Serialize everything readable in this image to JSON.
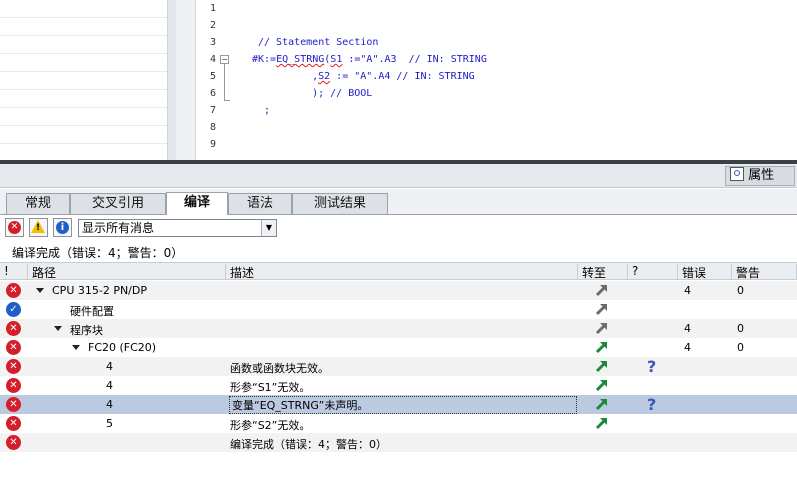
{
  "editor": {
    "line_numbers": [
      "1",
      "2",
      "3",
      "4",
      "5",
      "6",
      "7",
      "8",
      "9"
    ],
    "comment_line": "// Statement Section",
    "line4_prefix": "#K:=",
    "line4_func": "EQ_STRNG",
    "line4_paren": "(",
    "line4_param": "S1",
    "line4_rest": " :=\"A\".A3  // IN: STRING",
    "line5_prefix": "    ,",
    "line5_param": "S2",
    "line5_rest": " := \"A\".A4 // IN: STRING",
    "line6": "    ); // BOOL",
    "line7": ";"
  },
  "properties_button": {
    "label": "属性",
    "icon": "properties-icon"
  },
  "tabs": [
    {
      "label": "常规"
    },
    {
      "label": "交叉引用"
    },
    {
      "label": "编译",
      "active": true
    },
    {
      "label": "语法"
    },
    {
      "label": "测试结果"
    }
  ],
  "toolbar": {
    "filter_value": "显示所有消息"
  },
  "summary": "编译完成（错误：4；警告：0）",
  "columns": {
    "bang": "!",
    "path": "路径",
    "desc": "描述",
    "goto": "转至",
    "help": "?",
    "errors": "错误",
    "warnings": "警告"
  },
  "rows": [
    {
      "status": "error",
      "path": "CPU 315-2 PN/DP",
      "desc": "",
      "errors": "4",
      "warnings": "0",
      "help": false
    },
    {
      "status": "ok",
      "path": "硬件配置",
      "desc": "",
      "errors": "",
      "warnings": "",
      "help": false
    },
    {
      "status": "error",
      "path": "程序块",
      "desc": "",
      "errors": "4",
      "warnings": "0",
      "help": false
    },
    {
      "status": "error",
      "path": "FC20 (FC20)",
      "desc": "",
      "errors": "4",
      "warnings": "0",
      "help": false
    },
    {
      "status": "error",
      "path": "4",
      "desc": "函数或函数块无效。",
      "errors": "",
      "warnings": "",
      "help": true
    },
    {
      "status": "error",
      "path": "4",
      "desc": "形参“S1”无效。",
      "errors": "",
      "warnings": "",
      "help": false
    },
    {
      "status": "error",
      "path": "4",
      "desc": "变量“EQ_STRNG”未声明。",
      "errors": "",
      "warnings": "",
      "help": true
    },
    {
      "status": "error",
      "path": "5",
      "desc": "形参“S2”无效。",
      "errors": "",
      "warnings": "",
      "help": false
    },
    {
      "status": "error",
      "path": "",
      "desc": "编译完成（错误：4；警告：0）",
      "errors": "",
      "warnings": "",
      "help": false
    }
  ],
  "colors": {
    "error": "#d21f2b",
    "ok": "#1f5fc8",
    "selected_row": "#bccae1",
    "code_text": "#1c1cc8"
  }
}
